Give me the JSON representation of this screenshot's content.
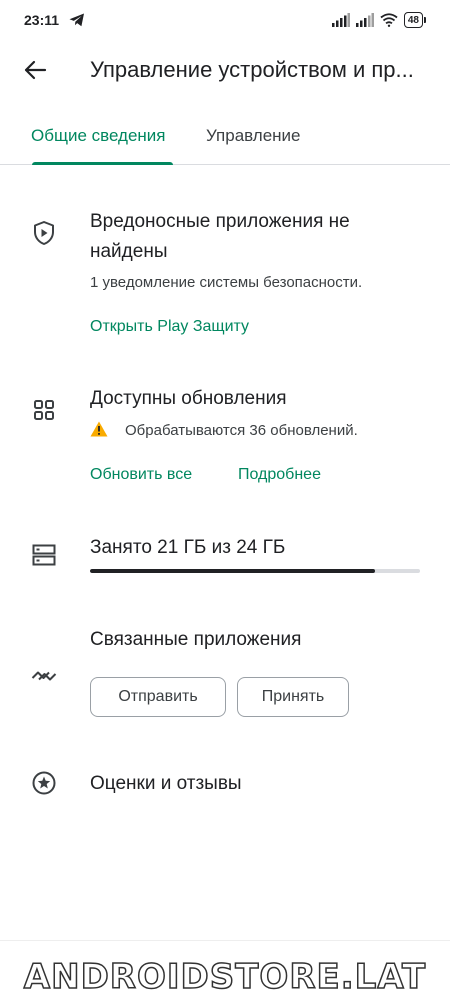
{
  "status_bar": {
    "time": "23:11",
    "battery": "48"
  },
  "app_bar": {
    "title": "Управление устройством и пр..."
  },
  "tabs": [
    {
      "label": "Общие сведения",
      "selected": true
    },
    {
      "label": "Управление",
      "selected": false
    }
  ],
  "protection": {
    "heading_line1": "Вредоносные приложения не",
    "heading_line2": "найдены",
    "subtitle": "1 уведомление системы безопасности.",
    "link": "Открыть Play Защиту"
  },
  "updates": {
    "heading": "Доступны обновления",
    "status": "Обрабатываются 36 обновлений.",
    "update_all": "Обновить все",
    "details": "Подробнее"
  },
  "storage": {
    "heading": "Занято 21 ГБ из 24 ГБ",
    "used_fraction": 0.865
  },
  "linked_apps": {
    "heading": "Связанные приложения",
    "send": "Отправить",
    "accept": "Принять"
  },
  "ratings": {
    "heading": "Оценки и отзывы"
  },
  "watermark": "ANDROIDSTORE.LAT",
  "colors": {
    "accent": "#01875f",
    "warning": "#f9ab00"
  }
}
